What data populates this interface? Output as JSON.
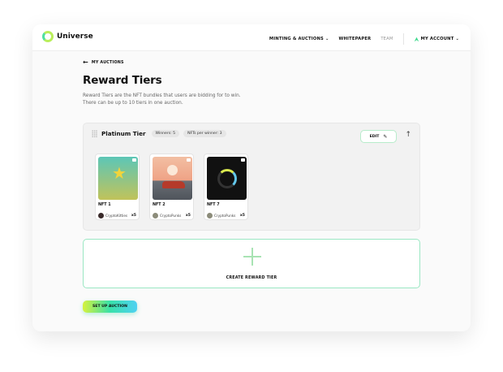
{
  "brand": {
    "name": "Universe"
  },
  "nav": {
    "minting": "MINTING & AUCTIONS",
    "whitepaper": "WHITEPAPER",
    "team": "TEAM",
    "account": "MY ACCOUNT"
  },
  "page": {
    "back_label": "MY AUCTIONS",
    "title": "Reward Tiers",
    "description_line1": "Reward Tiers are the NFT bundles that users are bidding for to win.",
    "description_line2": "There can be up to 10 tiers in one auction."
  },
  "tier": {
    "name": "Platinum Tier",
    "winners": "Winners: 5",
    "nfts_per_winner": "NFTs per winner: 3",
    "edit_label": "EDIT",
    "nfts": [
      {
        "name": "NFT 1",
        "owner": "CryptoKitties",
        "qty": "x5",
        "avatar_color": "#3a2b2b"
      },
      {
        "name": "NFT 2",
        "owner": "CryptoPunks",
        "qty": "x5",
        "avatar_color": "#8c8c7a"
      },
      {
        "name": "NFT 7",
        "owner": "CryptoPunks",
        "qty": "x5",
        "avatar_color": "#8c8c7a"
      }
    ]
  },
  "create_label": "CREATE REWARD TIER",
  "setup_label": "SET UP AUCTION",
  "colors": {
    "accent_gradient": [
      "#d6f23d",
      "#38e1a9",
      "#4ed1f2"
    ]
  }
}
